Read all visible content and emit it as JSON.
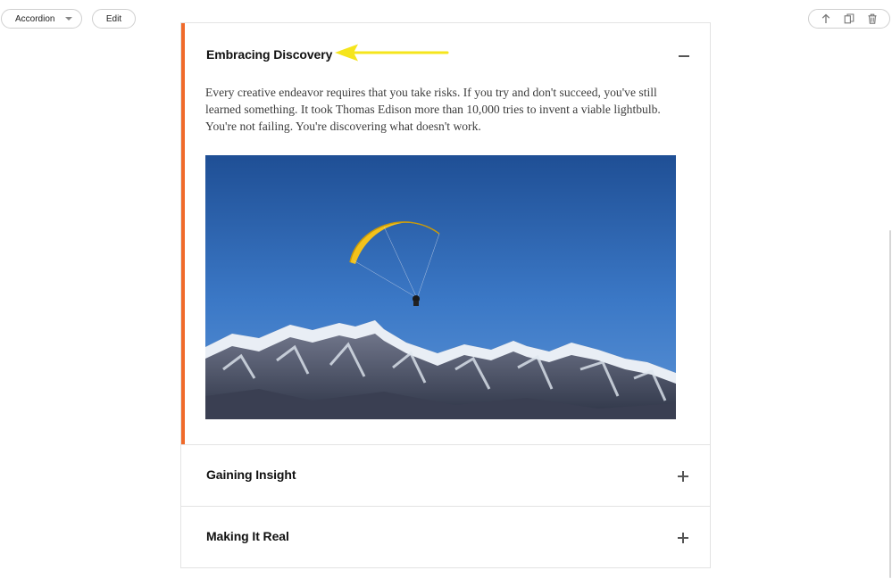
{
  "toolbar": {
    "block_type": "Accordion",
    "edit_label": "Edit",
    "actions": [
      "arrow-up-icon",
      "duplicate-icon",
      "trash-icon"
    ]
  },
  "accordion": {
    "accent_color": "#f06a2a",
    "panels": [
      {
        "title": "Embracing Discovery",
        "expanded": true,
        "toggle": "minus-icon",
        "body": "Every creative endeavor requires that you take risks. If you try and don't succeed, you've still learned something. It took Thomas Edison more than 10,000 tries to invent a viable lightbulb. You're not failing. You're discovering what doesn't work.",
        "image": "paraglider over snowy mountains"
      },
      {
        "title": "Gaining Insight",
        "expanded": false,
        "toggle": "plus-icon"
      },
      {
        "title": "Making It Real",
        "expanded": false,
        "toggle": "plus-icon"
      }
    ]
  },
  "annotation": {
    "arrow_color": "#f5e51c"
  }
}
